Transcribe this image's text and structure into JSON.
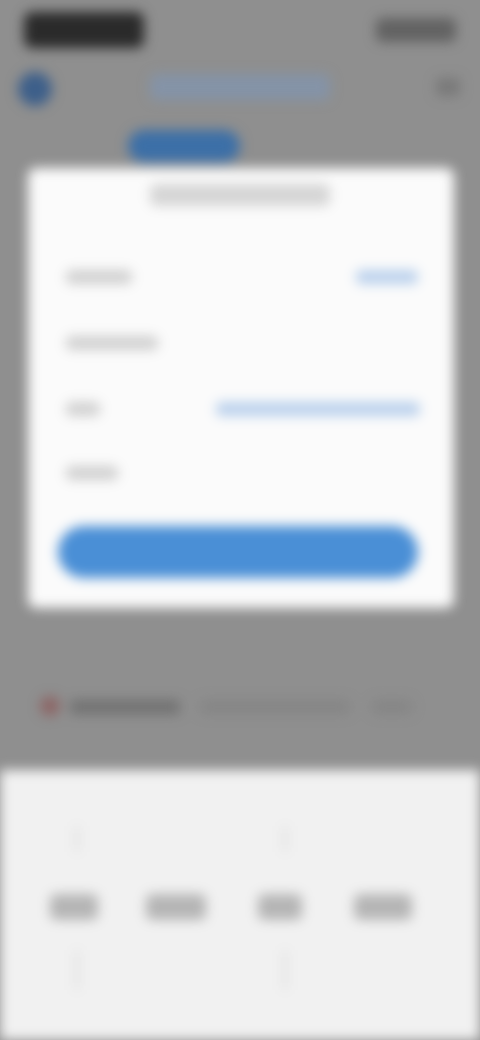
{
  "header": {
    "title": "",
    "action_pill": ""
  },
  "modal": {
    "title": "",
    "rows": [
      {
        "label": "",
        "value": ""
      },
      {
        "label": "",
        "value": ""
      },
      {
        "label": "",
        "value": ""
      },
      {
        "label": "",
        "value": ""
      }
    ],
    "confirm_label": ""
  },
  "bottom": {
    "tabs": [
      "",
      "",
      "",
      ""
    ]
  },
  "colors": {
    "accent": "#4a8fd6",
    "overlay": "#8f8f8f",
    "modal_bg": "#fbfbfb"
  }
}
